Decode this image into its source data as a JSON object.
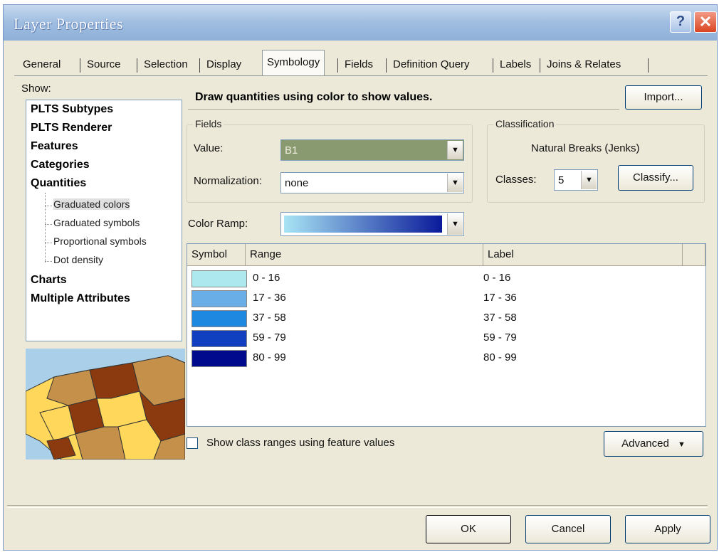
{
  "window": {
    "title": "Layer Properties"
  },
  "titlebar": {
    "help": "?",
    "close": "✕"
  },
  "tabs": [
    {
      "label": "General"
    },
    {
      "label": "Source"
    },
    {
      "label": "Selection"
    },
    {
      "label": "Display"
    },
    {
      "label": "Symbology",
      "active": true
    },
    {
      "label": "Fields"
    },
    {
      "label": "Definition Query"
    },
    {
      "label": "Labels"
    },
    {
      "label": "Joins & Relates"
    }
  ],
  "show": {
    "label": "Show:",
    "items": [
      "PLTS Subtypes",
      "PLTS Renderer",
      "Features",
      "Categories",
      "Quantities"
    ],
    "subitems": [
      "Graduated colors",
      "Graduated symbols",
      "Proportional symbols",
      "Dot density"
    ],
    "selected_subitem": "Graduated colors",
    "items_after": [
      "Charts",
      "Multiple Attributes"
    ]
  },
  "description": "Draw quantities using color to show values.",
  "import_label": "Import...",
  "fields": {
    "title": "Fields",
    "value_label": "Value:",
    "value": "B1",
    "normalization_label": "Normalization:",
    "normalization": "none"
  },
  "classification": {
    "title": "Classification",
    "method": "Natural Breaks (Jenks)",
    "classes_label": "Classes:",
    "classes": "5",
    "classify_label": "Classify..."
  },
  "color_ramp": {
    "label": "Color Ramp:",
    "from": "#a8e4f4",
    "to": "#0a1a9a"
  },
  "table": {
    "headers": [
      "Symbol",
      "Range",
      "Label"
    ],
    "rows": [
      {
        "color": "#aee8ef",
        "range": "0 - 16",
        "label": "0 - 16"
      },
      {
        "color": "#6aaee8",
        "range": "17 - 36",
        "label": "17 - 36"
      },
      {
        "color": "#1e88e0",
        "range": "37 - 58",
        "label": "37 - 58"
      },
      {
        "color": "#1040c0",
        "range": "59 - 79",
        "label": "59 - 79"
      },
      {
        "color": "#000a8c",
        "range": "80 - 99",
        "label": "80 - 99"
      }
    ]
  },
  "show_class_ranges_label": "Show class ranges using feature values",
  "show_class_ranges_checked": false,
  "advanced_label": "Advanced",
  "buttons": {
    "ok": "OK",
    "cancel": "Cancel",
    "apply": "Apply"
  }
}
